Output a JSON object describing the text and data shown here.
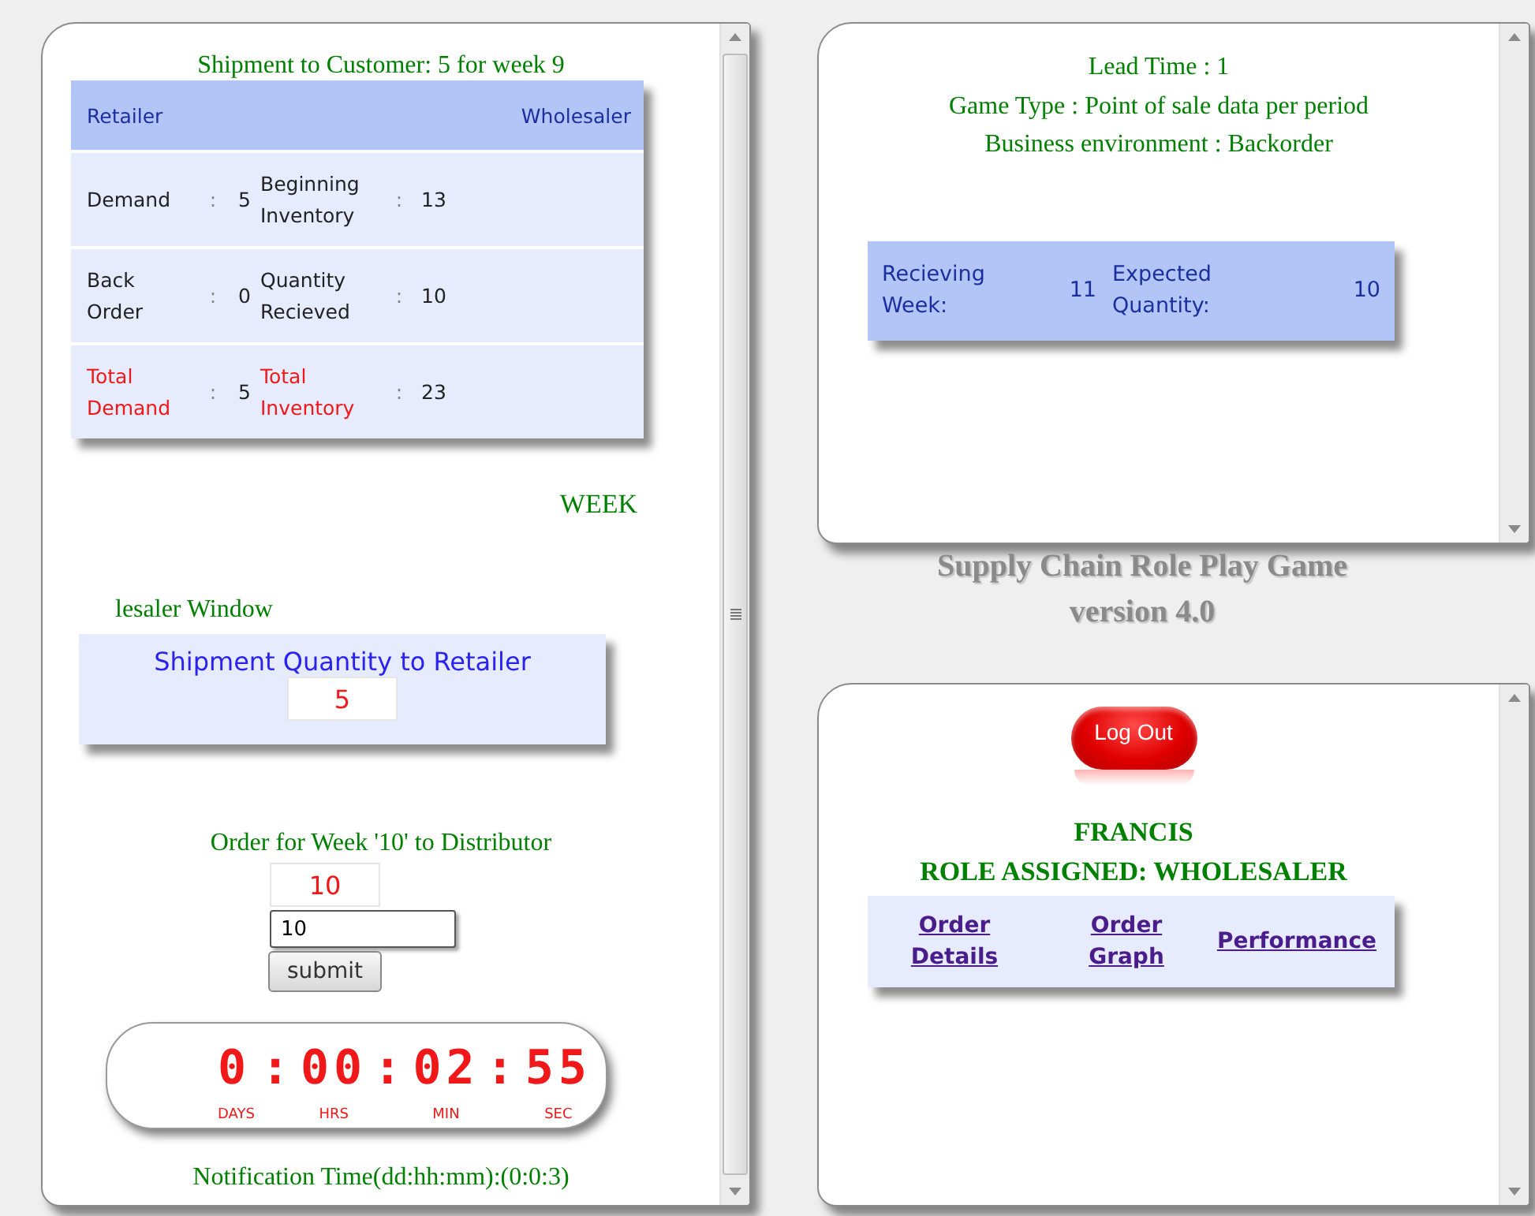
{
  "left_panel": {
    "title": "Shipment to Customer: 5 for week 9",
    "stock_table": {
      "columns": [
        "Retailer",
        "",
        "",
        "",
        "",
        "Wholesaler"
      ],
      "rows": [
        {
          "kind": "normal",
          "cells": [
            "Demand",
            ":",
            "5",
            "Beginning Inventory",
            ":",
            "13"
          ]
        },
        {
          "kind": "normal",
          "cells": [
            "Back Order",
            ":",
            "0",
            "Quantity Recieved",
            ":",
            "10"
          ]
        },
        {
          "kind": "total",
          "cells": [
            "Total Demand",
            ":",
            "5",
            "Total Inventory",
            ":",
            "23"
          ]
        }
      ]
    },
    "week_label": "WEEK",
    "window_label": "lesaler Window",
    "shipment_box": {
      "label": "Shipment Quantity to Retailer",
      "value": "5"
    },
    "order": {
      "label": "Order for Week '10' to Distributor",
      "display": "10",
      "input_value": "10",
      "button": "submit"
    },
    "timer": {
      "digits": [
        "0",
        ":",
        "00",
        ":",
        "02",
        ":",
        "55"
      ],
      "units": [
        "DAYS",
        "HRS",
        "MIN",
        "SEC"
      ]
    },
    "notification": "Notification Time(dd:hh:mm):(0:0:3)"
  },
  "game_info": {
    "lines": [
      "Lead Time : 1",
      "Game Type : Point of sale data per period",
      "Business environment : Backorder"
    ],
    "receiving": {
      "cells": [
        "Recieving Week:",
        "11",
        "Expected Quantity:",
        "10"
      ]
    }
  },
  "caption": [
    "Supply Chain Role Play Game",
    "version 4.0"
  ],
  "user_panel": {
    "logout": "Log Out",
    "name": "FRANCIS",
    "role": "ROLE ASSIGNED: WHOLESALER",
    "links": [
      "Order Details",
      "Order Graph",
      "Performance"
    ]
  }
}
